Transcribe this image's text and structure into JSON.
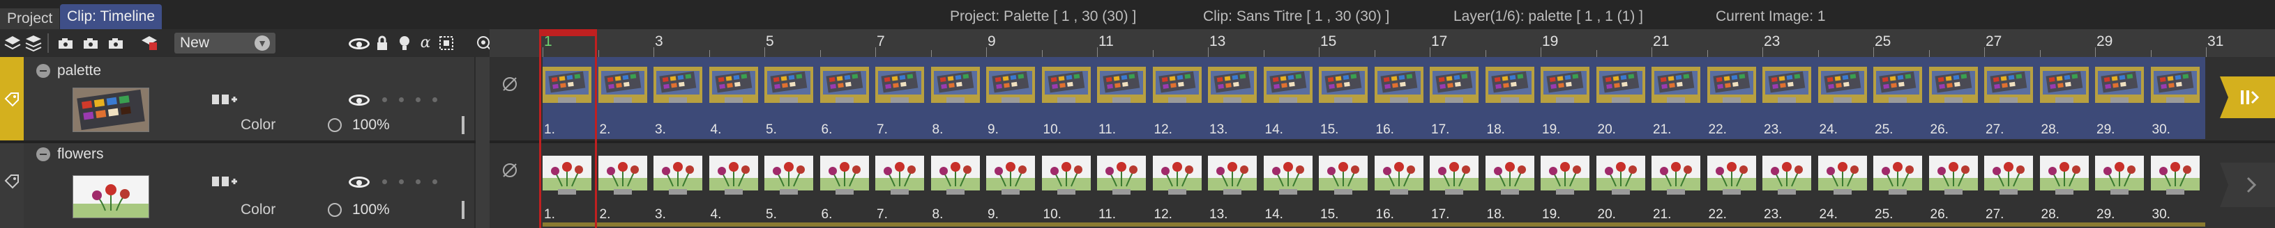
{
  "tabs": [
    {
      "label": "Project",
      "active": false
    },
    {
      "label": "Clip: Timeline",
      "active": true
    }
  ],
  "info": {
    "project": "Project: Palette [ 1 , 30  (30) ]",
    "clip": "Clip: Sans Titre [ 1 , 30  (30) ]",
    "layer": "Layer(1/6): palette [ 1 , 1  (1) ]",
    "current_image": "Current Image: 1"
  },
  "toolbar": {
    "icons": [
      "layers-stack-icon",
      "layers-down-icon",
      "camera-icon",
      "camera-add-icon",
      "camera-copy-icon",
      "delete-layer-icon"
    ],
    "new_dropdown": {
      "selected": "New"
    }
  },
  "layer_header_icons": [
    "visibility-eye-icon",
    "lock-icon",
    "light-icon",
    "alpha-icon",
    "select-box-icon",
    "onion-icon"
  ],
  "layers": [
    {
      "name": "palette",
      "color_label": "Color",
      "opacity": "100%",
      "accent": "#d4b01e",
      "selected": true
    },
    {
      "name": "flowers",
      "color_label": "Color",
      "opacity": "100%",
      "accent": "#4a4a4a",
      "selected": false
    }
  ],
  "ruler": {
    "labels": [
      "1",
      "3",
      "5",
      "7",
      "9",
      "11",
      "13",
      "15",
      "17",
      "19",
      "21",
      "23",
      "25",
      "27",
      "29",
      "31"
    ]
  },
  "frames": {
    "count": 30,
    "labels": [
      "1.",
      "2.",
      "3.",
      "4.",
      "5.",
      "6.",
      "7.",
      "8.",
      "9.",
      "10.",
      "11.",
      "12.",
      "13.",
      "14.",
      "15.",
      "16.",
      "17.",
      "18.",
      "19.",
      "20.",
      "21.",
      "22.",
      "23.",
      "24.",
      "25.",
      "26.",
      "27.",
      "28.",
      "29.",
      "30."
    ]
  },
  "current_frame": 1,
  "colors": {
    "accent_tab": "#3f4f88",
    "playhead": "#c02020",
    "palette_track": "#3d4a78",
    "palette_layer_accent": "#d4b01e"
  }
}
